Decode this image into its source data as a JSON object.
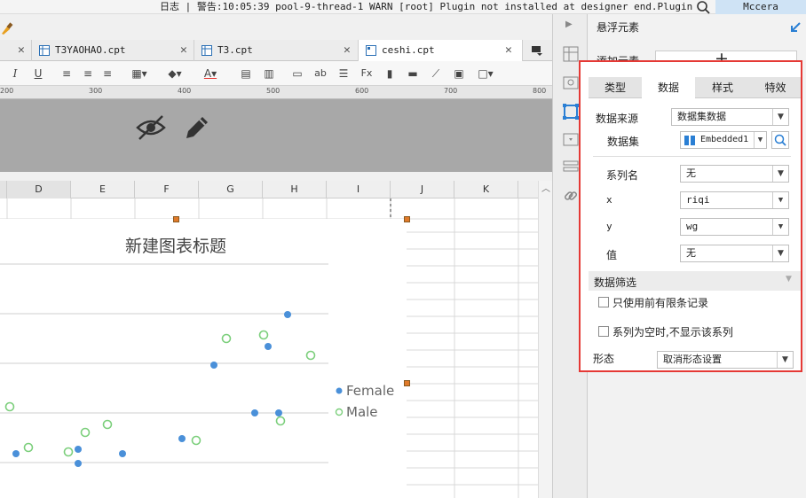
{
  "statusbar": {
    "log_text": "日志 | 警告:10:05:39 pool-9-thread-1 WARN [root] Plugin not installed at designer end.Plugin id:c...",
    "user": "Mccera"
  },
  "tabs": [
    {
      "label": "T3YAOHAO.cpt"
    },
    {
      "label": "T3.cpt"
    },
    {
      "label": "ceshi.cpt"
    }
  ],
  "ruler": {
    "marks": [
      "200",
      "300",
      "400",
      "500",
      "600",
      "700",
      "800"
    ]
  },
  "columns": [
    "D",
    "E",
    "F",
    "G",
    "H",
    "I",
    "J",
    "K"
  ],
  "chart_data": {
    "type": "scatter",
    "title": "新建图表标题",
    "series": [
      {
        "name": "Female",
        "color": "#4a90d9"
      },
      {
        "name": "Male",
        "color": "#7ccf7c"
      }
    ]
  },
  "panel": {
    "title": "悬浮元素",
    "add_label": "添加元素",
    "tabs": [
      "类型",
      "数据",
      "样式",
      "特效"
    ],
    "data_source_label": "数据来源",
    "data_source_value": "数据集数据",
    "dataset_label": "数据集",
    "dataset_value": "Embedded1",
    "series_label": "系列名",
    "series_value": "无",
    "x_label": "x",
    "x_value": "riqi",
    "y_label": "y",
    "y_value": "wg",
    "value_label": "值",
    "value_value": "无",
    "filter_label": "数据筛选",
    "limit_label": "只使用前有限条记录",
    "hide_empty_label": "系列为空时,不显示该系列",
    "form_label": "形态",
    "form_value": "取消形态设置"
  }
}
